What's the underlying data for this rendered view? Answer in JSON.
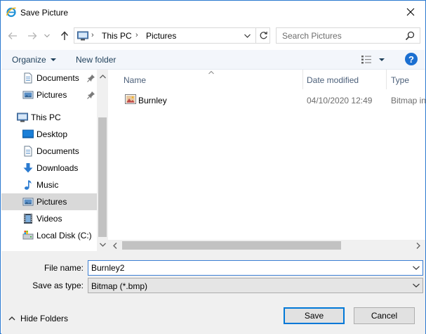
{
  "window": {
    "title": "Save Picture"
  },
  "address": {
    "crumbs": [
      "This PC",
      "Pictures"
    ]
  },
  "search": {
    "placeholder": "Search Pictures"
  },
  "toolbar": {
    "organize_label": "Organize",
    "new_folder_label": "New folder",
    "help_label": "?"
  },
  "sidebar": {
    "items": [
      {
        "label": "Documents",
        "icon": "documents-icon",
        "pinned": true
      },
      {
        "label": "Pictures",
        "icon": "pictures-icon",
        "pinned": true
      },
      {
        "label": "This PC",
        "icon": "computer-icon"
      },
      {
        "label": "Desktop",
        "icon": "desktop-icon"
      },
      {
        "label": "Documents",
        "icon": "documents-icon"
      },
      {
        "label": "Downloads",
        "icon": "downloads-icon"
      },
      {
        "label": "Music",
        "icon": "music-icon"
      },
      {
        "label": "Pictures",
        "icon": "pictures-icon",
        "selected": true
      },
      {
        "label": "Videos",
        "icon": "videos-icon"
      },
      {
        "label": "Local Disk (C:)",
        "icon": "drive-icon"
      }
    ]
  },
  "files": {
    "columns": [
      "Name",
      "Date modified",
      "Type"
    ],
    "rows": [
      {
        "name": "Burnley",
        "date": "04/10/2020 12:49",
        "type": "Bitmap in",
        "icon": "bitmap-file-icon"
      }
    ]
  },
  "form": {
    "file_name_label": "File name:",
    "file_name_value": "Burnley2",
    "save_type_label": "Save as type:",
    "save_type_value": "Bitmap (*.bmp)"
  },
  "footer": {
    "hide_folders_label": "Hide Folders",
    "save_label": "Save",
    "cancel_label": "Cancel"
  },
  "colors": {
    "accent": "#0078d7",
    "toolbar_bg": "#f3f6fb",
    "selected_bg": "#d9d9d9",
    "help_blue": "#1b6fd1"
  }
}
